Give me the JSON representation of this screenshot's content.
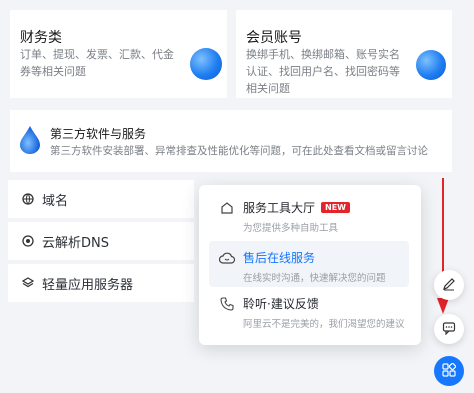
{
  "cards": {
    "finance": {
      "title": "财务类",
      "desc": "订单、提现、发票、汇款、代金券等相关问题"
    },
    "account": {
      "title": "会员账号",
      "desc": "换绑手机、换绑邮箱、账号实名认证、找回用户名、找回密码等相关问题"
    },
    "thirdparty": {
      "title": "第三方软件与服务",
      "desc": "第三方软件安装部署、异常排查及性能优化等问题，可在此处查看文档或留言讨论"
    }
  },
  "side_items": [
    {
      "label": "域名",
      "icon": "globe-icon"
    },
    {
      "label": "云解析DNS",
      "icon": "dns-icon"
    },
    {
      "label": "轻量应用服务器",
      "icon": "server-icon"
    }
  ],
  "popup": {
    "items": [
      {
        "title": "服务工具大厅",
        "badge": "NEW",
        "desc": "为您提供多种自助工具",
        "icon": "home-icon"
      },
      {
        "title": "售后在线服务",
        "desc": "在线实时沟通，快速解决您的问题",
        "icon": "cloud-icon"
      },
      {
        "title": "聆听·建议反馈",
        "desc": "阿里云不是完美的，我们渴望您的建议",
        "icon": "phone-icon"
      }
    ]
  },
  "colors": {
    "accent": "#1677ff",
    "badge": "#e3242b",
    "arrow": "#e3242b"
  }
}
